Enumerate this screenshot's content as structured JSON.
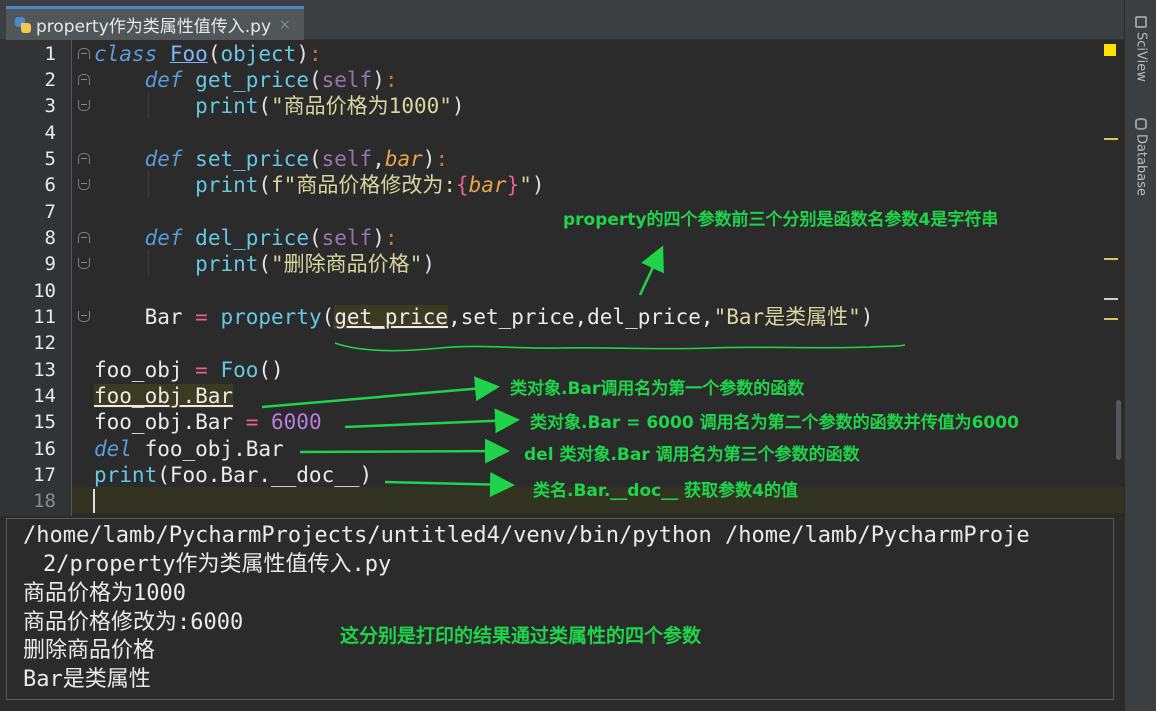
{
  "tab": {
    "filename": "property作为类属性值传入.py",
    "close_glyph": "×"
  },
  "right_tools": [
    {
      "label": "SciView",
      "icon": "sciview-icon"
    },
    {
      "label": "Database",
      "icon": "database-icon"
    }
  ],
  "line_numbers": [
    "1",
    "2",
    "3",
    "4",
    "5",
    "6",
    "7",
    "8",
    "9",
    "10",
    "11",
    "12",
    "13",
    "14",
    "15",
    "16",
    "17",
    "18"
  ],
  "code": {
    "l1": {
      "kw": "class",
      "name": "Foo",
      "lp": "(",
      "base": "object",
      "rp": ")",
      "colon": ":"
    },
    "l2": {
      "kw": "def",
      "name": "get_price",
      "lp": "(",
      "self": "self",
      "rp": ")",
      "colon": ":"
    },
    "l3": {
      "fn": "print",
      "lp": "(",
      "str": "\"商品价格为1000\"",
      "rp": ")"
    },
    "l5": {
      "kw": "def",
      "name": "set_price",
      "lp": "(",
      "self": "self",
      "comma": ",",
      "arg": "bar",
      "rp": ")",
      "colon": ":"
    },
    "l6": {
      "fn": "print",
      "lp": "(",
      "str1": "f\"商品价格修改为:",
      "lb": "{",
      "var": "bar",
      "rb": "}",
      "str2": "\"",
      "rp": ")"
    },
    "l8": {
      "kw": "def",
      "name": "del_price",
      "lp": "(",
      "self": "self",
      "rp": ")",
      "colon": ":"
    },
    "l9": {
      "fn": "print",
      "lp": "(",
      "str": "\"删除商品价格\"",
      "rp": ")"
    },
    "l11": {
      "var": "Bar ",
      "eq": "=",
      "fn": " property",
      "lp": "(",
      "a1": "get_price",
      "rest": ",set_price,del_price,",
      "str": "\"Bar是类属性\"",
      "rp": ")"
    },
    "l13": {
      "var": "foo_obj ",
      "eq": "=",
      "cls": " Foo",
      "call": "()"
    },
    "l14": {
      "text": "foo_obj.Bar"
    },
    "l15": {
      "var": "foo_obj.Bar ",
      "eq": "=",
      "num": " 6000"
    },
    "l16": {
      "kw": "del",
      "rest": " foo_obj.Bar"
    },
    "l17": {
      "fn": "print",
      "rest": "(Foo.Bar.__doc__)"
    }
  },
  "annotations": {
    "property_note": "property的四个参数前三个分别是函数名参数4是字符串",
    "line14_note": "类对象.Bar调用名为第一个参数的函数",
    "line15_note": "类对象.Bar = 6000 调用名为第二个参数的函数并传值为6000",
    "line16_note": "del 类对象.Bar 调用名为第三个参数的函数",
    "line17_note": "类名.Bar.__doc__ 获取参数4的值",
    "console_note": "这分别是打印的结果通过类属性的四个参数"
  },
  "console": {
    "cmd_line1": "/home/lamb/PycharmProjects/untitled4/venv/bin/python /home/lamb/PycharmProje",
    "cmd_line2": "2/property作为类属性值传入.py",
    "out1": "商品价格为1000",
    "out2": "商品价格修改为:6000",
    "out3": "删除商品价格",
    "out4": "Bar是类属性"
  },
  "colors": {
    "annotation_green": "#1fd44a",
    "tab_accent": "#4a88c7",
    "warning_marker": "#ffe100"
  }
}
